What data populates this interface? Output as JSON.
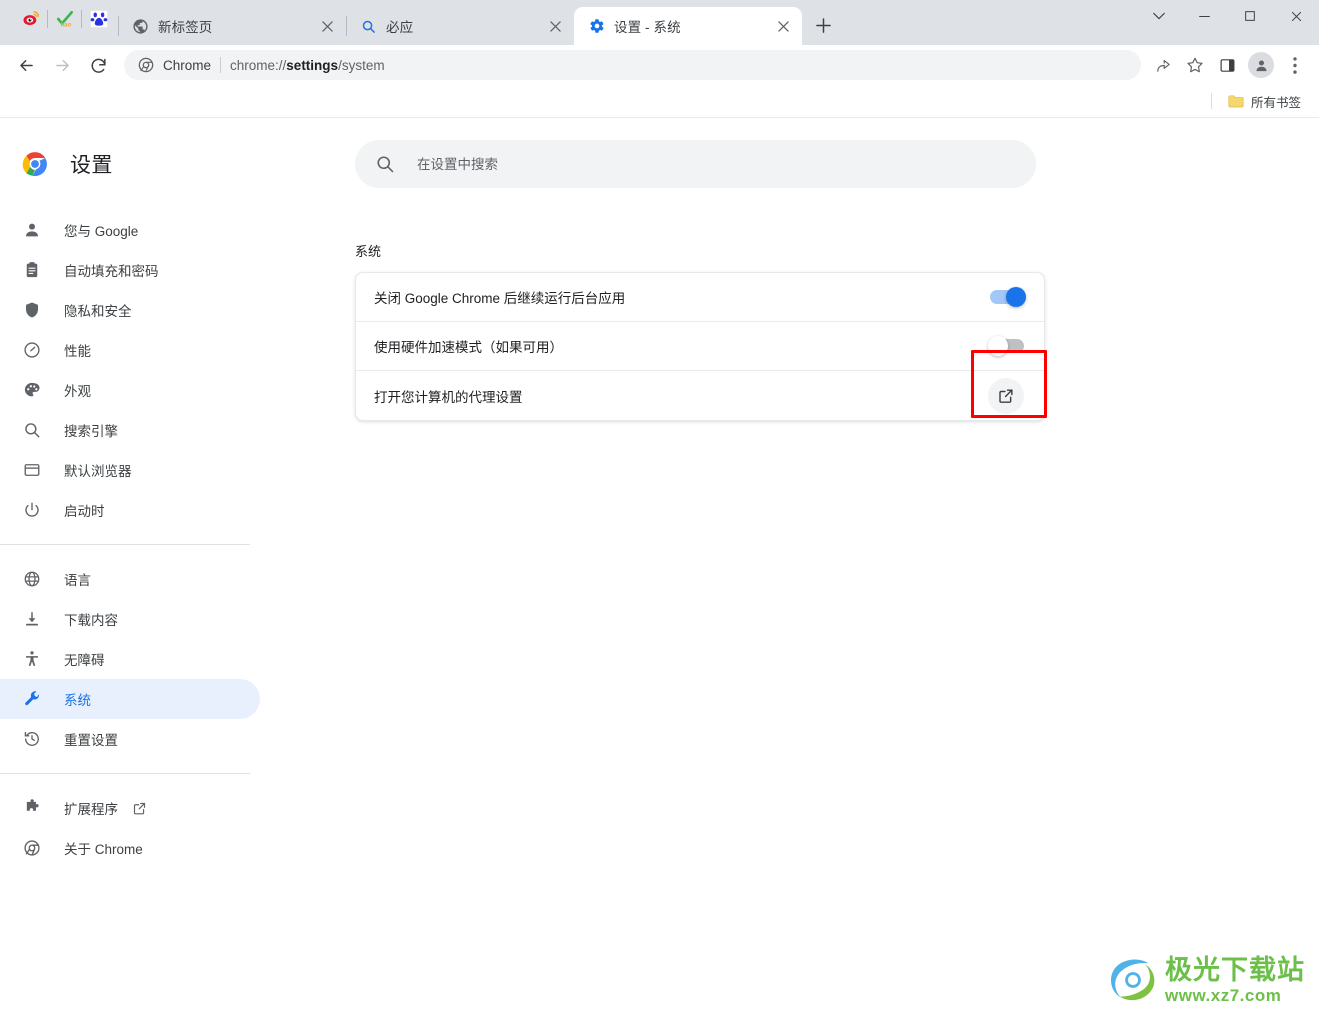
{
  "window": {
    "controls": {
      "tab_search": "tab-search",
      "minimize": "minimize",
      "maximize": "maximize",
      "close": "close"
    }
  },
  "tabstrip": {
    "pinned_tabs": [
      {
        "name": "weibo",
        "title": "微博"
      },
      {
        "name": "hao123",
        "title": "hao"
      },
      {
        "name": "baidu",
        "title": "百度"
      }
    ],
    "tabs": [
      {
        "title": "新标签页",
        "icon": "globe-icon",
        "active": false,
        "close_label": "✕"
      },
      {
        "title": "必应",
        "icon": "search-icon",
        "active": false,
        "close_label": "✕"
      },
      {
        "title": "设置 - 系统",
        "icon": "gear-icon",
        "active": true,
        "close_label": "✕"
      }
    ],
    "new_tab_label": "+"
  },
  "toolbar": {
    "back": "←",
    "forward": "→",
    "reload": "⟳",
    "omnibox": {
      "chip": "Chrome",
      "url_prefix": "chrome://",
      "url_bold": "settings",
      "url_suffix": "/system",
      "full_url": "chrome://settings/system"
    },
    "share_label": "share-icon",
    "bookmark_label": "star-icon",
    "sidepanel_label": "side-panel-icon",
    "profile_label": "avatar",
    "menu_label": "⋮"
  },
  "bookmarks_bar": {
    "all_bookmarks_label": "所有书签"
  },
  "sidebar": {
    "brand_title": "设置",
    "groups": [
      {
        "items": [
          {
            "label": "您与 Google",
            "icon": "person-icon",
            "selected": false
          },
          {
            "label": "自动填充和密码",
            "icon": "clipboard-icon",
            "selected": false
          },
          {
            "label": "隐私和安全",
            "icon": "shield-icon",
            "selected": false
          },
          {
            "label": "性能",
            "icon": "speedometer-icon",
            "selected": false
          },
          {
            "label": "外观",
            "icon": "palette-icon",
            "selected": false
          },
          {
            "label": "搜索引擎",
            "icon": "search-icon",
            "selected": false
          },
          {
            "label": "默认浏览器",
            "icon": "browser-window-icon",
            "selected": false
          },
          {
            "label": "启动时",
            "icon": "power-icon",
            "selected": false
          }
        ]
      },
      {
        "items": [
          {
            "label": "语言",
            "icon": "globe-icon",
            "selected": false
          },
          {
            "label": "下载内容",
            "icon": "download-icon",
            "selected": false
          },
          {
            "label": "无障碍",
            "icon": "accessibility-icon",
            "selected": false
          },
          {
            "label": "系统",
            "icon": "wrench-icon",
            "selected": true
          },
          {
            "label": "重置设置",
            "icon": "history-restore-icon",
            "selected": false
          }
        ]
      },
      {
        "items": [
          {
            "label": "扩展程序",
            "icon": "puzzle-icon",
            "selected": false,
            "external": true
          },
          {
            "label": "关于 Chrome",
            "icon": "chrome-outline-icon",
            "selected": false
          }
        ]
      }
    ]
  },
  "main": {
    "search": {
      "placeholder": "在设置中搜索",
      "value": ""
    },
    "section_title": "系统",
    "rows": [
      {
        "label": "关闭 Google Chrome 后继续运行后台应用",
        "control": "toggle",
        "state": "on"
      },
      {
        "label": "使用硬件加速模式（如果可用）",
        "control": "toggle",
        "state": "off"
      },
      {
        "label": "打开您计算机的代理设置",
        "control": "external-link-button",
        "state": ""
      }
    ]
  },
  "annotation": {
    "highlight_color": "#ff0000",
    "target": "external-link-button"
  },
  "watermark": {
    "title": "极光下载站",
    "url": "www.xz7.com"
  },
  "colors": {
    "accent": "#1a73e8",
    "selected_bg": "#e8f0fe",
    "tabstrip_bg": "#dee1e6",
    "omnibox_bg": "#f1f3f4",
    "highlight": "#ff0000"
  }
}
